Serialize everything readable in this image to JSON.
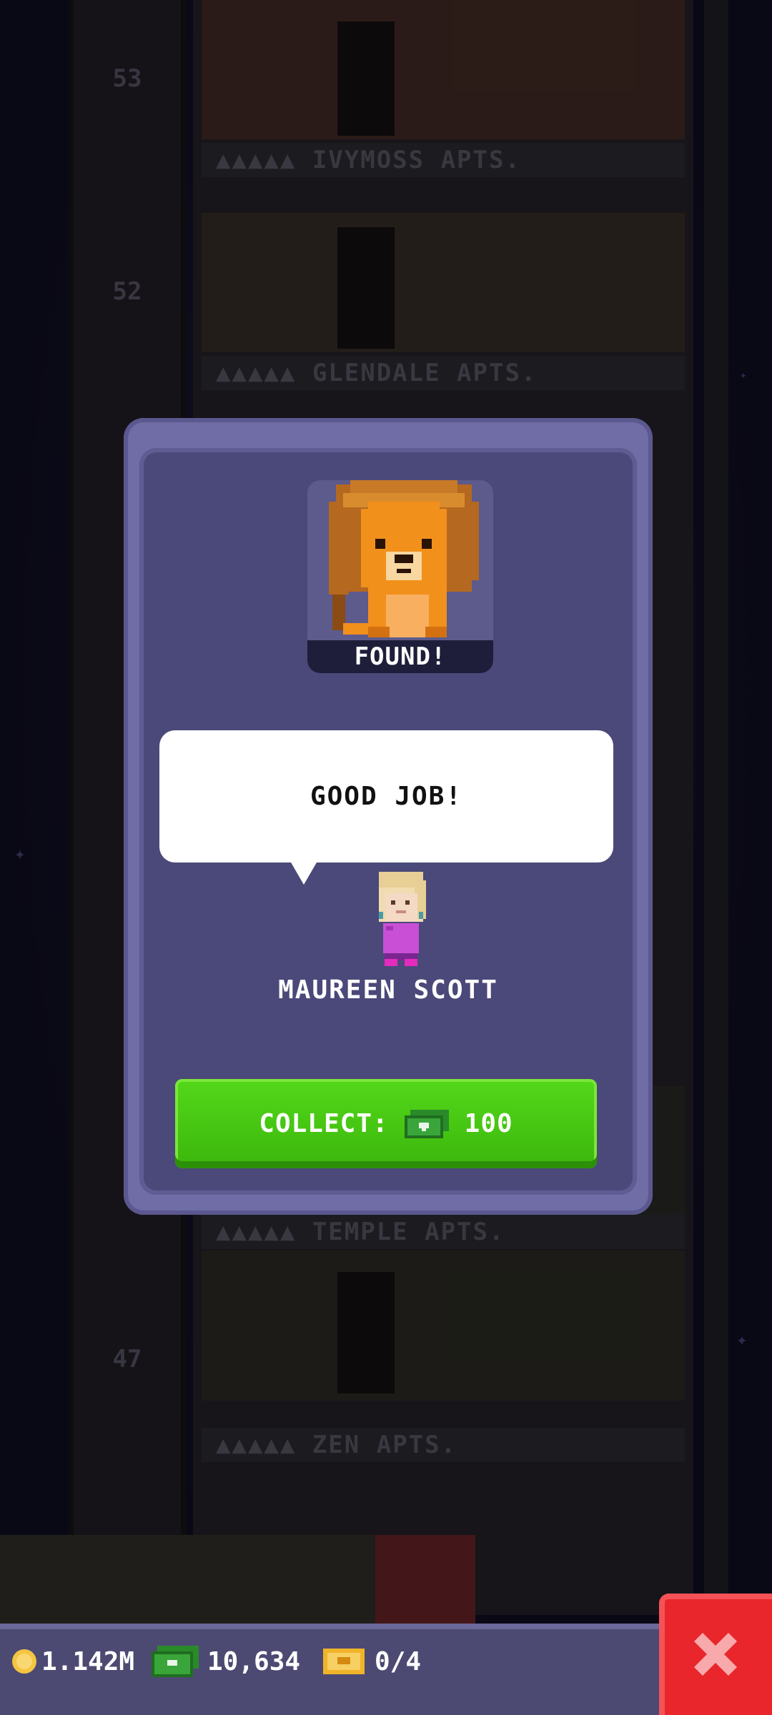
{
  "background": {
    "floor_numbers": [
      "53",
      "52",
      "47"
    ],
    "floor_labels": [
      "IVYMOSS APTS.",
      "GLENDALE APTS.",
      "TEMPLE APTS.",
      "ZEN APTS."
    ]
  },
  "modal": {
    "found_label": "FOUND!",
    "speech_text": "GOOD JOB!",
    "character_name": "MAUREEN SCOTT",
    "collect": {
      "label": "COLLECT:",
      "amount": "100"
    }
  },
  "status_bar": {
    "coins": "1.142M",
    "bux": "10,634",
    "tickets": "0/4"
  },
  "colors": {
    "modal_frame": "#6f6ca6",
    "modal_fill": "#4b4979",
    "collect_green": "#46c810",
    "close_red": "#e8262b",
    "coin_gold": "#f5c542"
  },
  "icons": {
    "pet": "lion-pet-icon",
    "bux": "bux-icon",
    "coin": "coin-icon",
    "ticket": "golden-ticket-icon",
    "close": "close-icon"
  }
}
